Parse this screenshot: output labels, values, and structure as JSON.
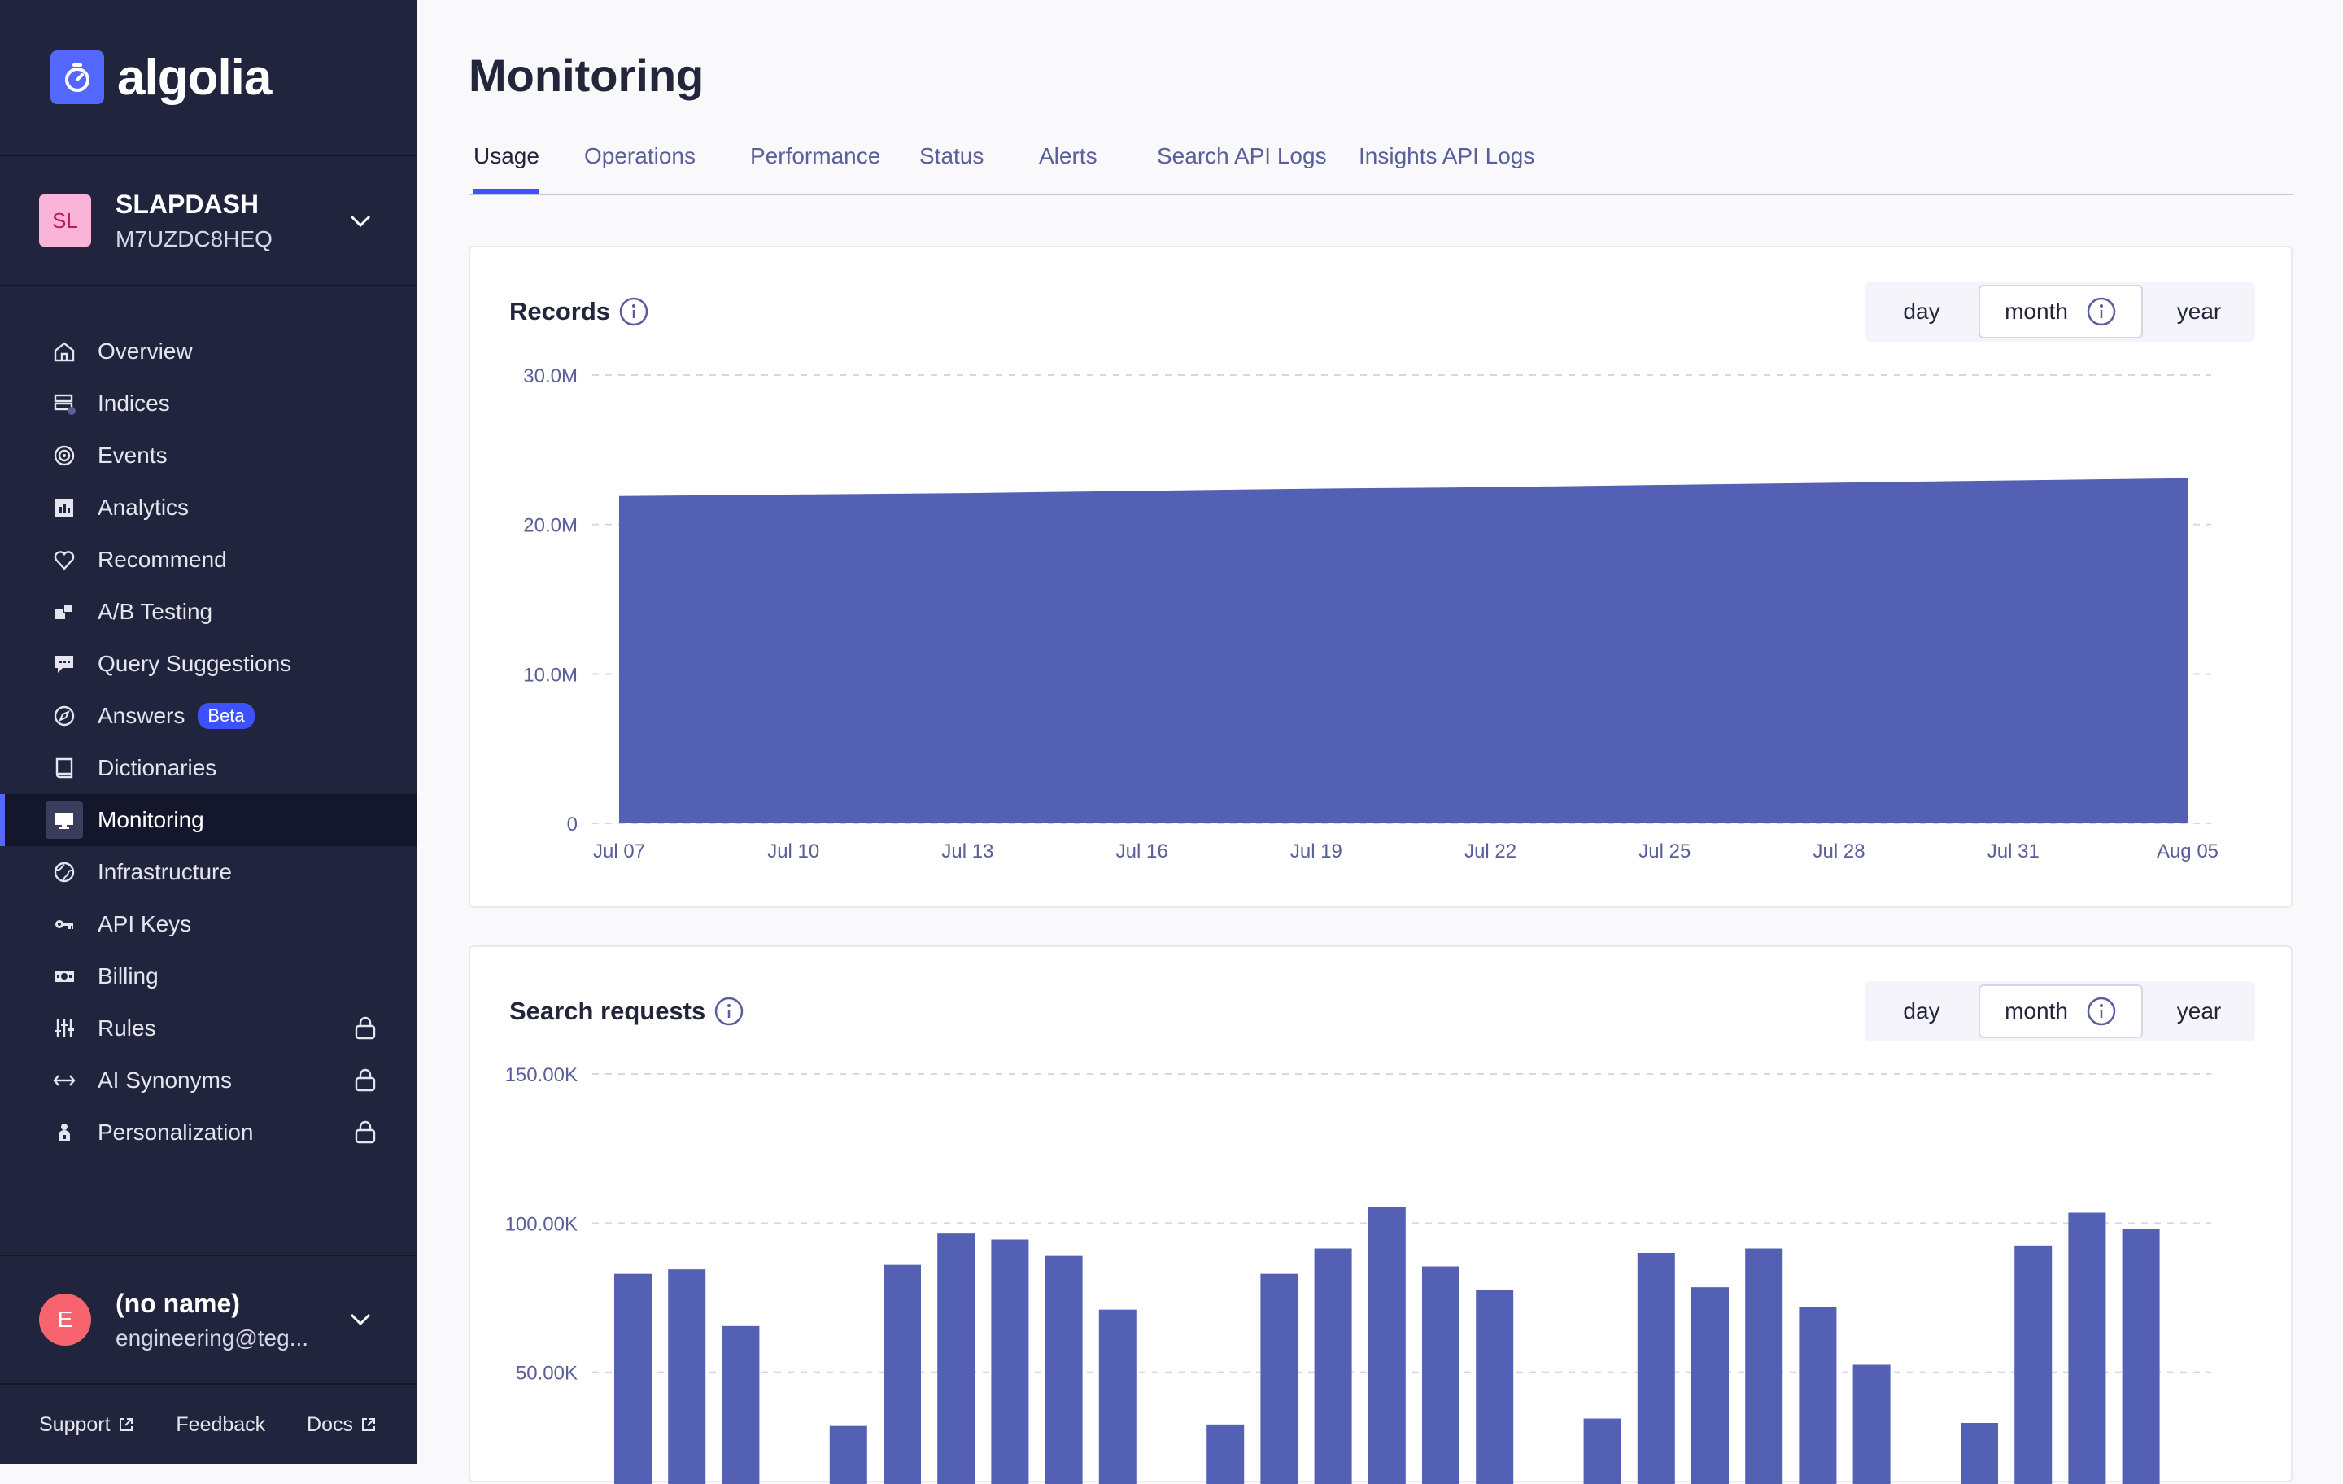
{
  "brand": {
    "name": "algolia"
  },
  "app": {
    "initials": "SL",
    "name": "SLAPDASH",
    "id": "M7UZDC8HEQ"
  },
  "nav": [
    {
      "label": "Overview",
      "icon": "home-icon",
      "active": false,
      "locked": false
    },
    {
      "label": "Indices",
      "icon": "indices-icon",
      "active": false,
      "locked": false
    },
    {
      "label": "Events",
      "icon": "target-icon",
      "active": false,
      "locked": false
    },
    {
      "label": "Analytics",
      "icon": "bar-chart-icon",
      "active": false,
      "locked": false
    },
    {
      "label": "Recommend",
      "icon": "heart-icon",
      "active": false,
      "locked": false
    },
    {
      "label": "A/B Testing",
      "icon": "ab-testing-icon",
      "active": false,
      "locked": false
    },
    {
      "label": "Query Suggestions",
      "icon": "speech-bubble-icon",
      "active": false,
      "locked": false
    },
    {
      "label": "Answers",
      "icon": "compass-icon",
      "active": false,
      "locked": false,
      "badge": "Beta"
    },
    {
      "label": "Dictionaries",
      "icon": "book-icon",
      "active": false,
      "locked": false
    },
    {
      "label": "Monitoring",
      "icon": "monitor-icon",
      "active": true,
      "locked": false
    },
    {
      "label": "Infrastructure",
      "icon": "globe-icon",
      "active": false,
      "locked": false
    },
    {
      "label": "API Keys",
      "icon": "key-icon",
      "active": false,
      "locked": false
    },
    {
      "label": "Billing",
      "icon": "banknote-icon",
      "active": false,
      "locked": false
    },
    {
      "label": "Rules",
      "icon": "sliders-icon",
      "active": false,
      "locked": true
    },
    {
      "label": "AI Synonyms",
      "icon": "arrows-horizontal-icon",
      "active": false,
      "locked": true
    },
    {
      "label": "Personalization",
      "icon": "person-icon",
      "active": false,
      "locked": true
    }
  ],
  "user": {
    "initial": "E",
    "name": "(no name)",
    "email": "engineering@teg..."
  },
  "footer": {
    "support": "Support",
    "feedback": "Feedback",
    "docs": "Docs"
  },
  "page": {
    "title": "Monitoring"
  },
  "tabs": [
    "Usage",
    "Operations",
    "Performance",
    "Status",
    "Alerts",
    "Search API Logs",
    "Insights API Logs"
  ],
  "active_tab": "Usage",
  "range_options": [
    "day",
    "month",
    "year"
  ],
  "selected_range": "month",
  "colors": {
    "accent": "#3d52ff",
    "series": "#5460b4",
    "sidebar": "#21243d"
  },
  "chart_data": [
    {
      "type": "area",
      "title": "Records",
      "ylim": [
        0,
        30000000
      ],
      "y_ticks": [
        "0",
        "10.0M",
        "20.0M",
        "30.0M"
      ],
      "x_ticks": [
        "Jul 07",
        "Jul 10",
        "Jul 13",
        "Jul 16",
        "Jul 19",
        "Jul 22",
        "Jul 25",
        "Jul 28",
        "Jul 31",
        "Aug 05"
      ],
      "x": [
        "Jul 07",
        "Jul 10",
        "Jul 13",
        "Jul 16",
        "Jul 19",
        "Jul 22",
        "Jul 25",
        "Jul 28",
        "Jul 31",
        "Aug 05"
      ],
      "values": [
        21900000,
        22000000,
        22100000,
        22250000,
        22400000,
        22500000,
        22650000,
        22800000,
        22950000,
        23100000
      ],
      "grid": true
    },
    {
      "type": "bar",
      "title": "Search requests",
      "ylim": [
        0,
        150000
      ],
      "y_ticks": [
        "50.00K",
        "100.00K",
        "150.00K"
      ],
      "values": [
        83000,
        84500,
        65500,
        null,
        32000,
        86000,
        96500,
        94500,
        89000,
        71000,
        null,
        32500,
        83000,
        91500,
        105500,
        85500,
        77500,
        null,
        34500,
        90000,
        78500,
        91500,
        72000,
        52500,
        null,
        33000,
        92500,
        103500,
        98000
      ],
      "grid": true
    }
  ]
}
